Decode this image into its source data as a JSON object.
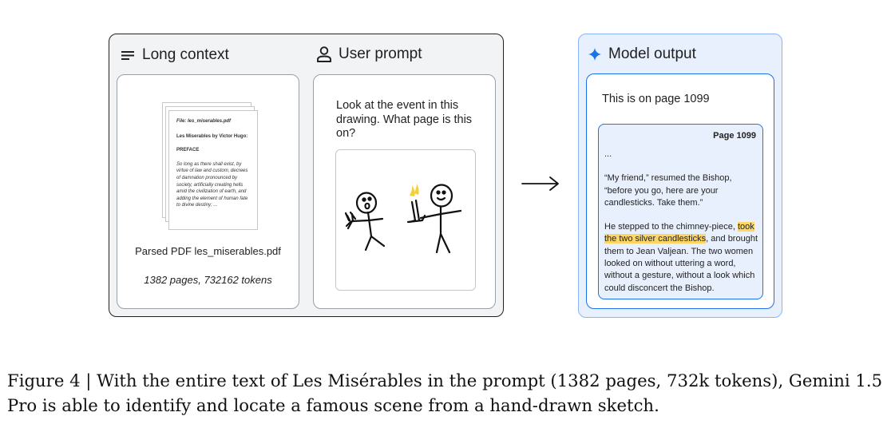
{
  "long_context": {
    "title": "Long context",
    "icon": "lines-menu-icon",
    "doc_file": "File: les_miserables.pdf",
    "doc_title": "Les Miserables by Victor Hugo:",
    "doc_heading": "PREFACE",
    "doc_excerpt": "So long as there shall exist, by virtue of law and custom, decrees of damnation pronounced by society, artificially creating hells amid the civilization of earth, and adding the element of human fate to divine destiny; ...",
    "parsed_label": "Parsed PDF les_miserables.pdf",
    "stats": "1382 pages, 732162 tokens"
  },
  "user_prompt": {
    "title": "User prompt",
    "icon": "person-icon",
    "text": "Look at the event in this drawing. What page is this on?",
    "drawing": "stick-figure-sketch"
  },
  "model_output": {
    "title": "Model output",
    "icon": "sparkle-icon",
    "answer": "This is on page 1099",
    "page_label": "Page 1099",
    "ellipsis": "...",
    "para1": "“My friend,” resumed the Bishop, “before you go, here are your candlesticks. Take them.”",
    "para2_before": "He stepped to the chimney-piece, ",
    "para2_highlight": "took the two silver candlesticks",
    "para2_after": ", and brought them to Jean Valjean. The two women looked on without uttering a word, without a gesture, without a look which could disconcert the Bishop.",
    "highlight_color": "#fdd663"
  },
  "arrow_icon": "right-arrow-icon",
  "caption": "Figure 4 | With the entire text of Les Misérables in the prompt (1382 pages, 732k tokens), Gemini 1.5 Pro is able to identify and locate a famous scene from a hand-drawn sketch."
}
